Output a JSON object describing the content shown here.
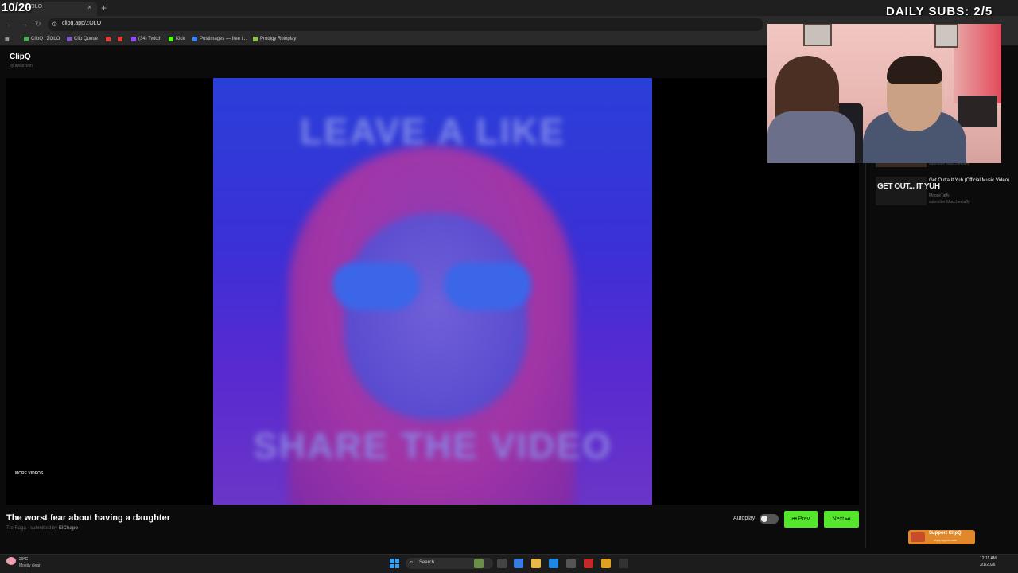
{
  "overlay": {
    "counter": "10/20",
    "daily_subs": "DAILY SUBS: 2/5"
  },
  "browser": {
    "tab_title": "ZOLO",
    "url": "clipq.app/ZOLO",
    "bookmarks": [
      {
        "label": "ClipQ | ZOLO",
        "color": "#4caf50"
      },
      {
        "label": "Clip Queue",
        "color": "#7e57c2"
      },
      {
        "label": "",
        "color": "#e53935"
      },
      {
        "label": "",
        "color": "#e53935"
      },
      {
        "label": "(34) Twitch",
        "color": "#9146ff"
      },
      {
        "label": "Kick",
        "color": "#53fc18"
      },
      {
        "label": "Postimages — free i...",
        "color": "#3b82f6"
      },
      {
        "label": "Prodigy Roleplay",
        "color": "#8bc34a"
      }
    ]
  },
  "app": {
    "name": "ClipQ",
    "byline": "by awaitTesh"
  },
  "video": {
    "overlay_top": "LEAVE A LIKE",
    "overlay_bottom": "SHARE THE VIDEO",
    "more_videos": "MORE VIDEOS"
  },
  "clip": {
    "title": "The worst fear about having a daughter",
    "author": "Tre Raga",
    "submitted_prefix": " - submitted by ",
    "submitter": "ElChapo"
  },
  "controls": {
    "autoplay_label": "Autoplay",
    "autoplay_on": false,
    "prev_label": "⏮ Prev",
    "next_label": "Next ⏭"
  },
  "queue": {
    "prev_item_submitter": "submitter Maccheetaffy",
    "items": [
      {
        "thumb_text": "GET OUT... IT YUH",
        "title": "Get Outta It Yuh (Official Music Video)",
        "channel": "MooseTaffy",
        "submitter": "submitter Maccheetaffy"
      }
    ]
  },
  "support": {
    "label": "Support ClipQ",
    "sub": "clipq.app/donate"
  },
  "taskbar": {
    "weather_temp": "20°C",
    "weather_desc": "Mostly clear",
    "search_placeholder": "Search",
    "time": "12:11 AM",
    "date": "3/1/2026"
  },
  "colors": {
    "accent_green": "#53e62a",
    "support_orange": "#e0882a"
  }
}
